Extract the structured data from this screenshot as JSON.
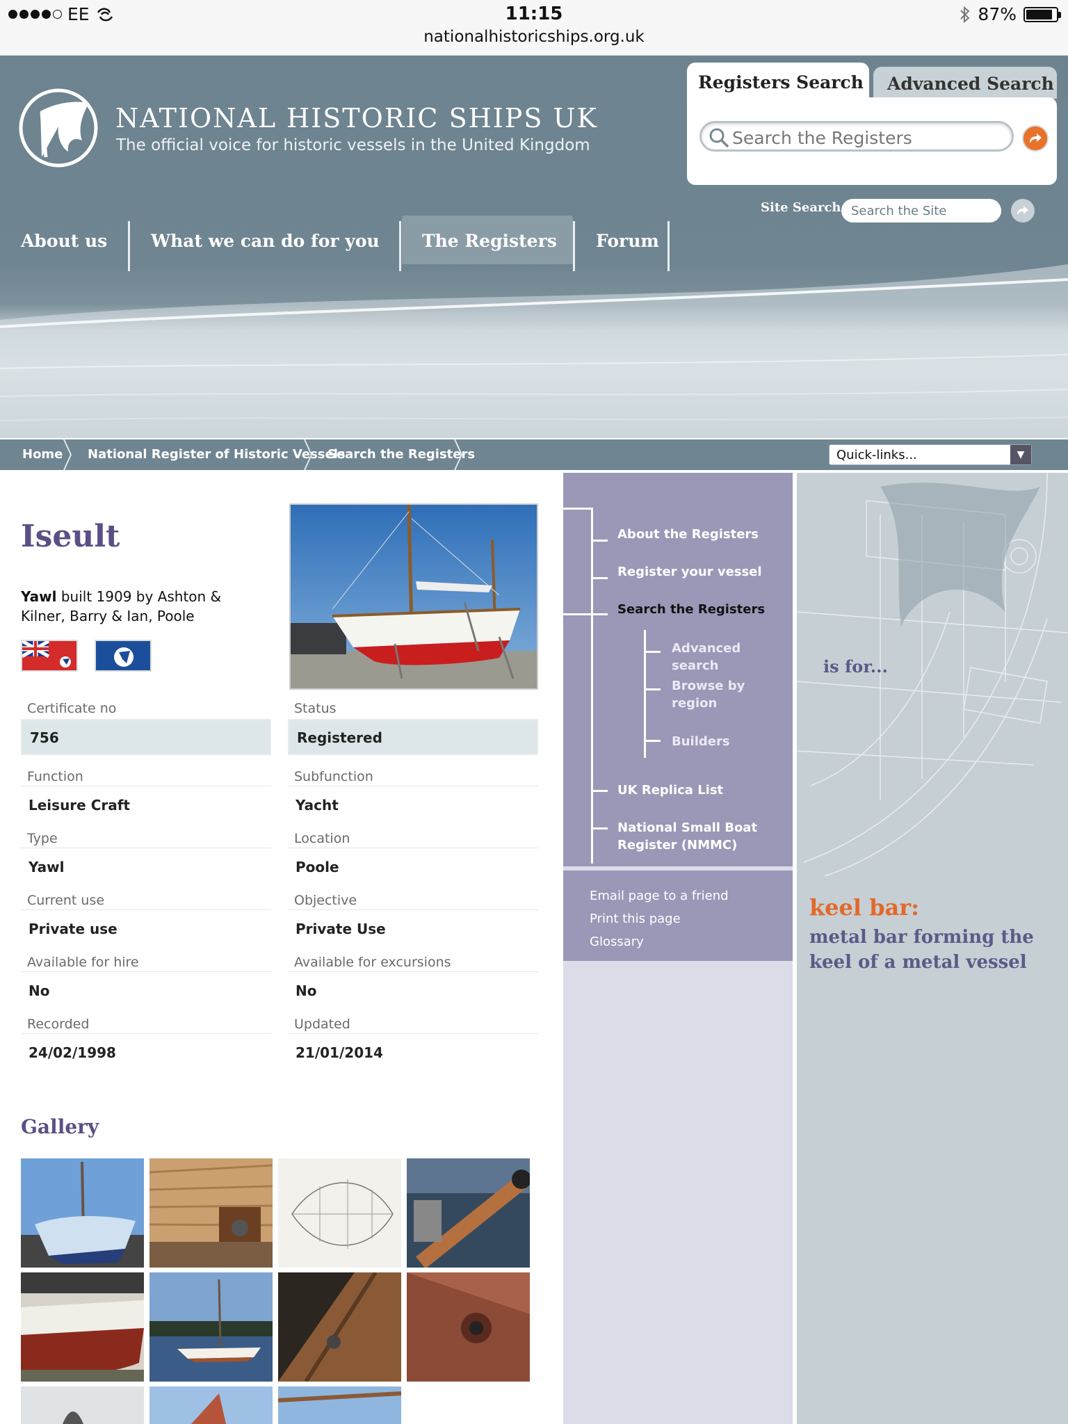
{
  "status_bar": {
    "carrier": "EE",
    "time": "11:15",
    "url": "nationalhistoricships.org.uk",
    "battery": "87%",
    "battery_level": 0.87
  },
  "header": {
    "title": "NATIONAL HISTORIC SHIPS UK",
    "tagline": "The official voice for historic vessels in the United Kingdom",
    "search_tabs": [
      "Registers Search",
      "Advanced Search"
    ],
    "registers_search_placeholder": "Search the Registers",
    "site_search_label": "Site Search:",
    "site_search_placeholder": "Search the Site",
    "nav": [
      "About us",
      "What we can do for you",
      "The Registers",
      "Forum"
    ],
    "active_nav": "The Registers"
  },
  "breadcrumb": {
    "items": [
      "Home",
      "National Register of Historic Vessels",
      "Search the Registers"
    ],
    "quicklinks": "Quick-links..."
  },
  "vessel": {
    "name": "Iseult",
    "type_bold": "Yawl",
    "description": " built 1909 by Ashton & Kilner, Barry & Ian, Poole",
    "fields": [
      {
        "label": "Certificate no",
        "value": "756"
      },
      {
        "label": "Status",
        "value": "Registered"
      },
      {
        "label": "Function",
        "value": "Leisure Craft"
      },
      {
        "label": "Subfunction",
        "value": "Yacht"
      },
      {
        "label": "Type",
        "value": "Yawl"
      },
      {
        "label": "Location",
        "value": "Poole"
      },
      {
        "label": "Current use",
        "value": "Private use"
      },
      {
        "label": "Objective",
        "value": "Private Use"
      },
      {
        "label": "Available for hire",
        "value": "No"
      },
      {
        "label": "Available for excursions",
        "value": "No"
      },
      {
        "label": "Recorded",
        "value": "24/02/1998"
      },
      {
        "label": "Updated",
        "value": "21/01/2014"
      }
    ]
  },
  "gallery": {
    "title": "Gallery"
  },
  "sidebar": {
    "items": [
      "About the Registers",
      "Register your vessel",
      "Search the Registers",
      "Advanced search",
      "Browse by region",
      "Builders",
      "UK Replica List",
      "National Small Boat Register (NMMC)"
    ],
    "current": "Search the Registers",
    "utilities": [
      "Email page to a friend",
      "Print this page",
      "Glossary"
    ]
  },
  "glossary": {
    "intro": "is for...",
    "term": "keel bar:",
    "definition": "metal bar forming the keel of a metal vessel"
  }
}
